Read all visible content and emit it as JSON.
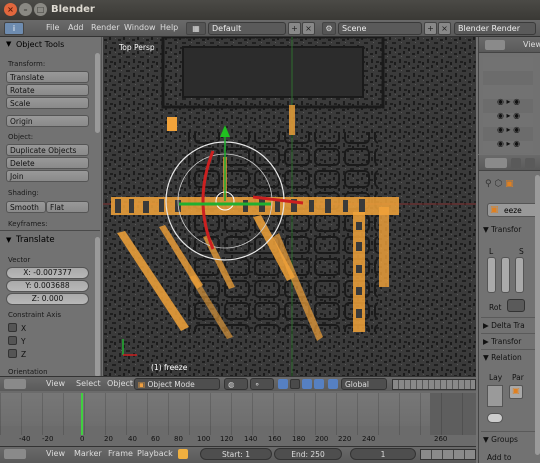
{
  "window": {
    "title": "Blender"
  },
  "menubar": {
    "items": [
      "File",
      "Add",
      "Render",
      "Window",
      "Help"
    ],
    "layout": "Default",
    "scene": "Scene",
    "engine": "Blender Render"
  },
  "toolshelf": {
    "title": "Object Tools",
    "transform_label": "Transform:",
    "translate": "Translate",
    "rotate": "Rotate",
    "scale": "Scale",
    "origin": "Origin",
    "object_label": "Object:",
    "duplicate": "Duplicate Objects",
    "delete": "Delete",
    "join": "Join",
    "shading_label": "Shading:",
    "smooth": "Smooth",
    "flat": "Flat",
    "keyframes_label": "Keyframes:",
    "op_title": "Translate",
    "vector_label": "Vector",
    "x": "X: -0.007377",
    "y": "Y: 0.003688",
    "z": "Z: 0.000",
    "constraint_label": "Constraint Axis",
    "cx": "X",
    "cy": "Y",
    "cz": "Z",
    "orientation_label": "Orientation"
  },
  "viewport": {
    "view_name": "Top Persp",
    "object_label": "(1) freeze"
  },
  "view_header": {
    "view": "View",
    "select": "Select",
    "object": "Object",
    "mode": "Object Mode",
    "orientation": "Global"
  },
  "timeline": {
    "ticks": [
      "-40",
      "-20",
      "0",
      "20",
      "40",
      "60",
      "80",
      "100",
      "120",
      "140",
      "160",
      "180",
      "200",
      "220",
      "240",
      "260"
    ],
    "footer": {
      "view": "View",
      "marker": "Marker",
      "frame": "Frame",
      "playback": "Playback",
      "start": "Start: 1",
      "end": "End: 250",
      "current": "1"
    }
  },
  "outliner": {
    "view": "View"
  },
  "properties": {
    "object_name": "eeze",
    "transform": "Transfor",
    "l": "L",
    "s": "S",
    "rot": "Rot",
    "delta": "Delta Tra",
    "transform2": "Transfor",
    "relations": "Relation",
    "lay": "Lay",
    "par": "Par",
    "groups": "Groups",
    "add_to": "Add to"
  }
}
